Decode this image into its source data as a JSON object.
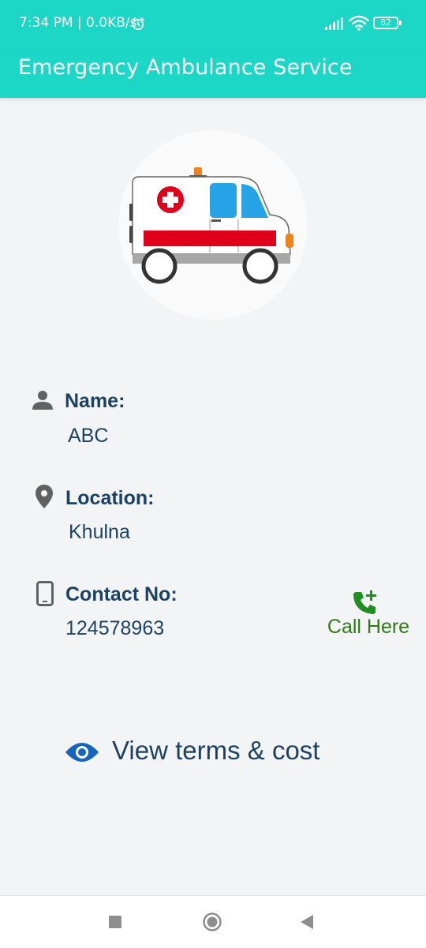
{
  "status_bar": {
    "time": "7:34 PM | 0.0KB/s",
    "battery": "82",
    "icons": [
      "alarm-icon",
      "signal-icon",
      "wifi-icon",
      "battery-icon"
    ]
  },
  "app_bar": {
    "title": "Emergency Ambulance Service"
  },
  "details": {
    "name_label": "Name:",
    "name_value": "ABC",
    "location_label": "Location:",
    "location_value": "Khulna",
    "contact_label": "Contact No:",
    "contact_value": "124578963"
  },
  "call_button": {
    "label": "Call Here",
    "icon": "phone-add-icon"
  },
  "terms_link": {
    "label": "View terms & cost",
    "icon": "eye-icon"
  },
  "nav_bar": {
    "icons": [
      "recents-square-icon",
      "home-circle-icon",
      "back-triangle-icon"
    ]
  },
  "colors": {
    "app_bar": "#1cd6c6",
    "text_primary": "#1b4263",
    "call_green": "#2f7a17",
    "phone_icon_green": "#1f8f1f",
    "eye_blue": "#1565c0",
    "background": "#f3f4f6"
  }
}
